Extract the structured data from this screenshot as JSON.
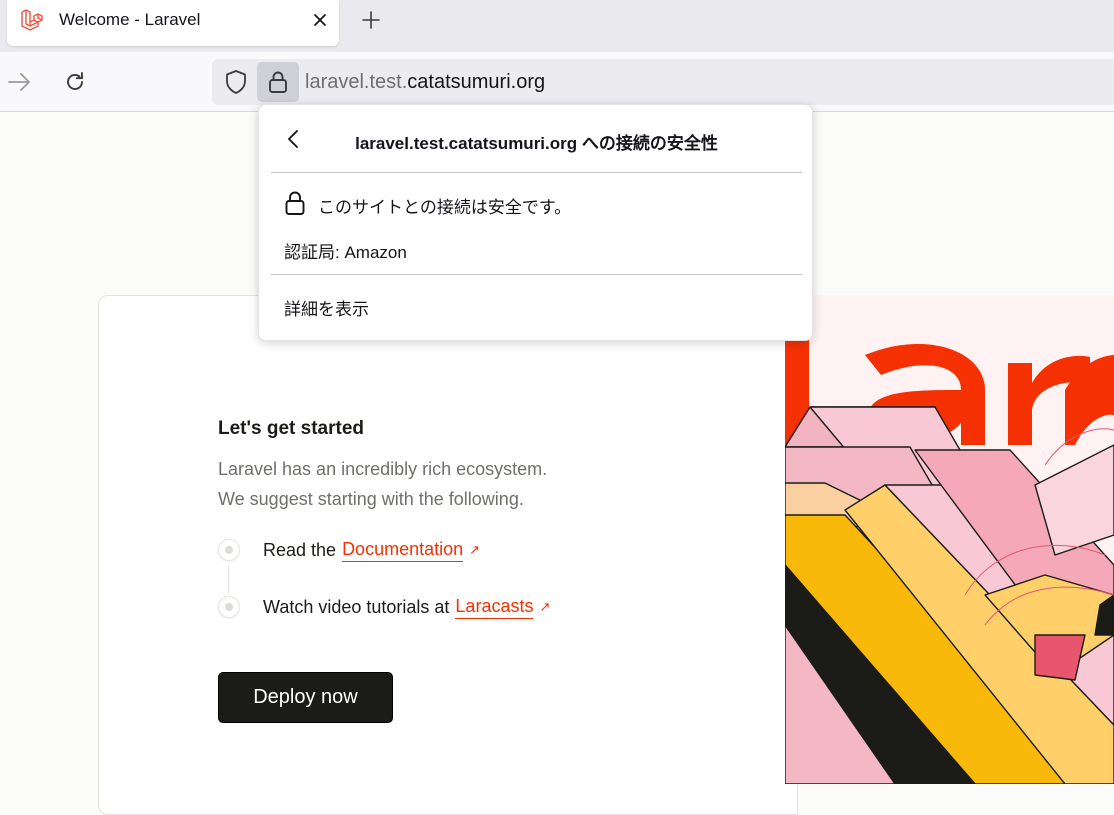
{
  "browser": {
    "tab": {
      "title": "Welcome - Laravel",
      "favicon": "laravel-logo-icon"
    },
    "new_tab_label": "+",
    "url": {
      "dim_part": "laravel.test.",
      "main_part": "catatsumuri.org"
    }
  },
  "popup": {
    "title": "laravel.test.catatsumuri.org への接続の安全性",
    "secure_text": "このサイトとの接続は安全です。",
    "issuer": "認証局: Amazon",
    "more_info": "詳細を表示"
  },
  "page": {
    "heading": "Let's get started",
    "description_line1": "Laravel has an incredibly rich ecosystem.",
    "description_line2": "We suggest starting with the following.",
    "steps": [
      {
        "prefix": "Read the",
        "link": "Documentation"
      },
      {
        "prefix": "Watch video tutorials at",
        "link": "Laracasts"
      }
    ],
    "deploy_label": "Deploy now"
  },
  "colors": {
    "accent": "#f53003",
    "dark": "#1b1b18",
    "muted": "#706f6c"
  }
}
